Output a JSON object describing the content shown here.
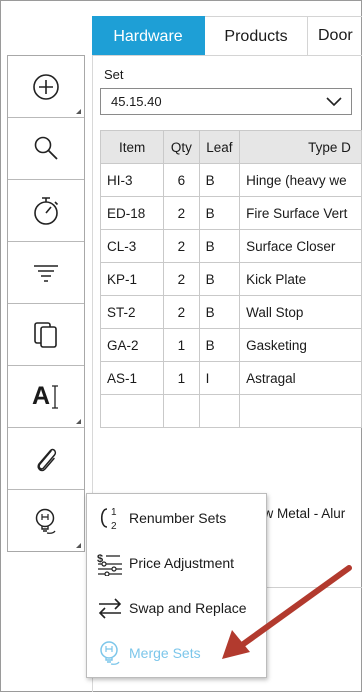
{
  "tabs": [
    {
      "label": "Hardware",
      "active": true
    },
    {
      "label": "Products",
      "active": false
    },
    {
      "label": "Door",
      "active": false
    }
  ],
  "toolbar": {
    "tools": [
      {
        "icon": "add-circle-icon",
        "has_submenu": true
      },
      {
        "icon": "search-icon",
        "has_submenu": false
      },
      {
        "icon": "stopwatch-icon",
        "has_submenu": false
      },
      {
        "icon": "filter-lines-icon",
        "has_submenu": false
      },
      {
        "icon": "copy-pages-icon",
        "has_submenu": false
      },
      {
        "icon": "text-cursor-icon",
        "text": "A",
        "has_submenu": true
      },
      {
        "icon": "paperclip-icon",
        "has_submenu": false
      },
      {
        "icon": "bulb-tools-icon",
        "has_submenu": true
      }
    ]
  },
  "set": {
    "label": "Set",
    "value": "45.15.40"
  },
  "table": {
    "headers": [
      "Item",
      "Qty",
      "Leaf",
      "Type D"
    ],
    "rows": [
      [
        "HI-3",
        "6",
        "B",
        "Hinge (heavy we"
      ],
      [
        "ED-18",
        "2",
        "B",
        "Fire Surface Vert"
      ],
      [
        "CL-3",
        "2",
        "B",
        "Surface Closer"
      ],
      [
        "KP-1",
        "2",
        "B",
        "Kick Plate"
      ],
      [
        "ST-2",
        "2",
        "B",
        "Wall Stop"
      ],
      [
        "GA-2",
        "1",
        "B",
        "Gasketing"
      ],
      [
        "AS-1",
        "1",
        "I",
        "Astragal"
      ],
      [
        "",
        "",
        "",
        ""
      ]
    ]
  },
  "description_fragment": "ow Metal - Alur",
  "menu": {
    "items": [
      {
        "label": "Renumber Sets",
        "icon": "renumber-icon",
        "disabled": false
      },
      {
        "label": "Price Adjustment",
        "icon": "price-adjust-icon",
        "disabled": false
      },
      {
        "label": "Swap and Replace",
        "icon": "swap-arrows-icon",
        "disabled": false
      },
      {
        "label": "Merge Sets",
        "icon": "merge-bulb-icon",
        "disabled": true
      }
    ]
  },
  "colors": {
    "accent": "#1e9fd6",
    "disabled_text": "#7cc6ea",
    "annotation_arrow": "#b23a2e"
  }
}
